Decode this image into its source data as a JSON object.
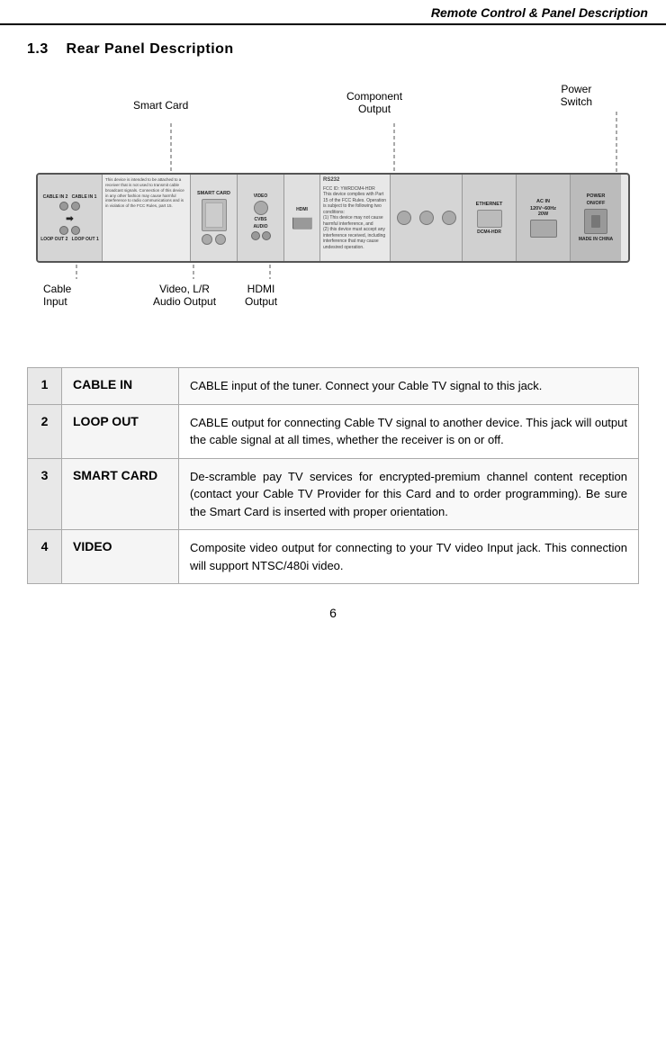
{
  "header": {
    "title": "Remote Control & Panel Description"
  },
  "section": {
    "number": "1.3",
    "title": "Rear Panel Description"
  },
  "diagram": {
    "labels": {
      "smart_card": "Smart Card",
      "component_output": "Component\nOutput",
      "power_switch": "Power\nSwitch",
      "cable_input_line1": "Cable",
      "cable_input_line2": "Input",
      "video_audio_line1": "Video, L/R",
      "video_audio_line2": "Audio Output",
      "hdmi_line1": "HDMI",
      "hdmi_line2": "Output"
    }
  },
  "table": {
    "rows": [
      {
        "num": "1",
        "name": "CABLE IN",
        "desc": "CABLE input of the tuner.   Connect your Cable TV signal to this jack."
      },
      {
        "num": "2",
        "name": "LOOP OUT",
        "desc": "CABLE output for connecting Cable TV signal to another device.   This jack will output the cable signal at all times, whether the receiver is on or off."
      },
      {
        "num": "3",
        "name": "SMART CARD",
        "desc": "De-scramble pay TV services for encrypted-premium channel content reception (contact your Cable TV Provider for this Card and to order programming).   Be sure the Smart Card is inserted with proper orientation."
      },
      {
        "num": "4",
        "name": "VIDEO",
        "desc": "Composite video output for connecting to your TV video Input jack.   This connection will support NTSC/480i video."
      }
    ]
  },
  "page_number": "6"
}
